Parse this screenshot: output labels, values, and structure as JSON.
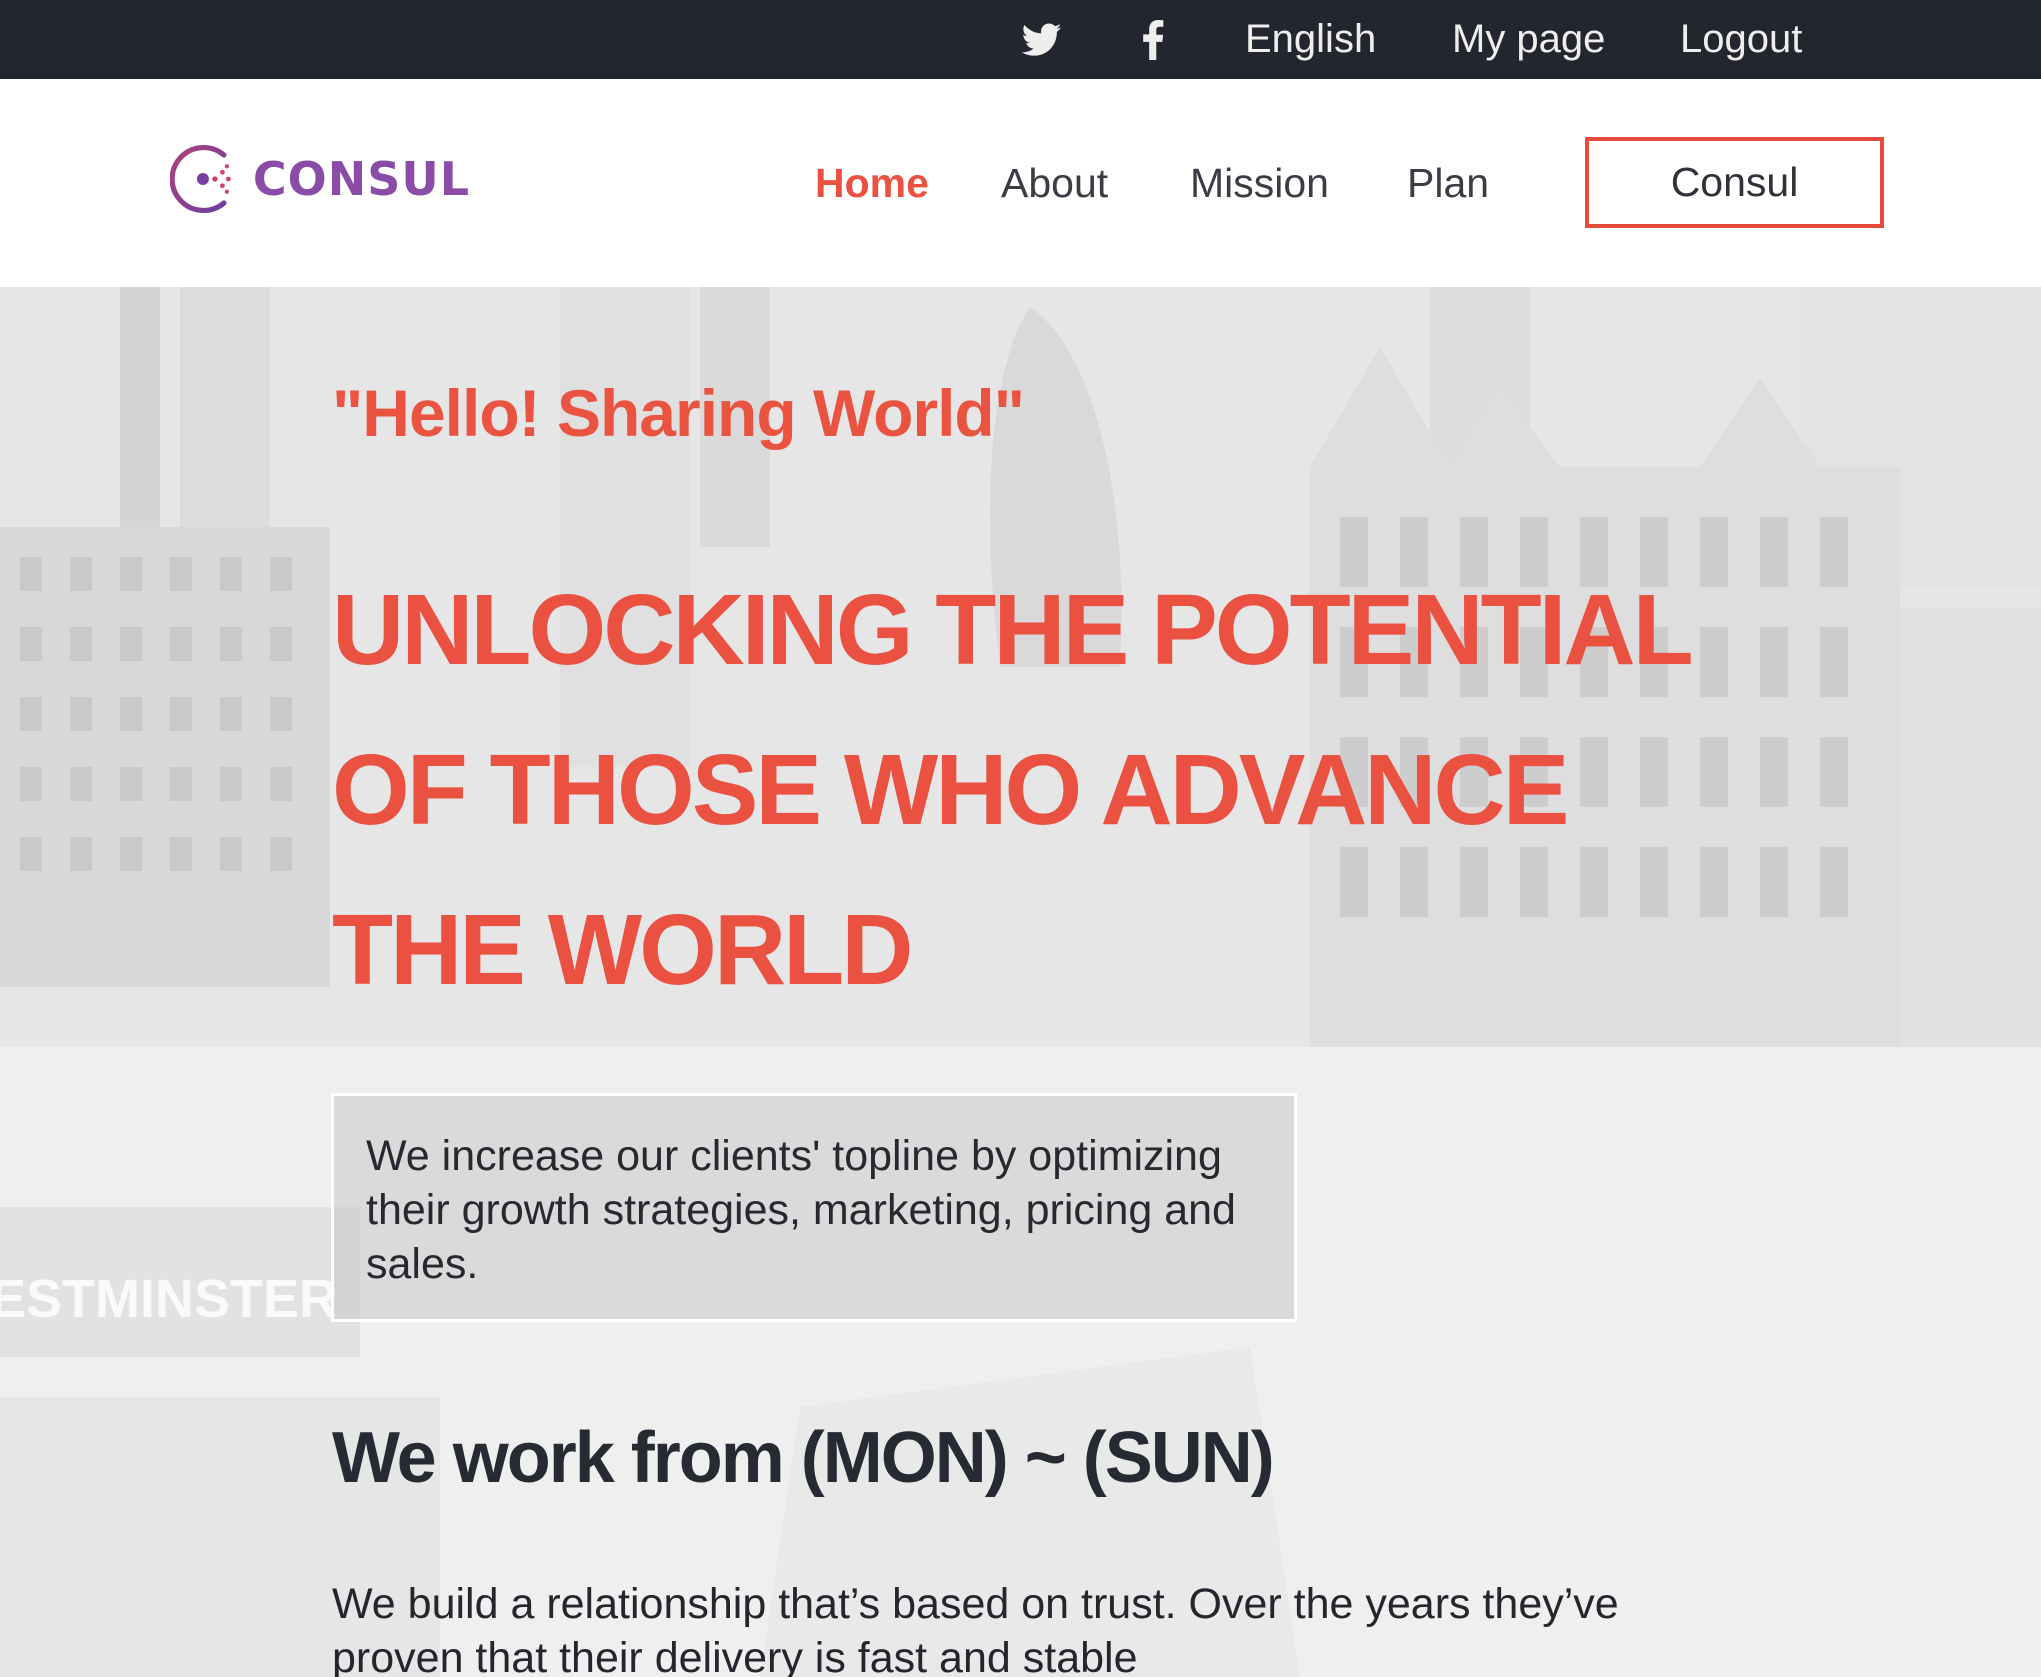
{
  "topbar": {
    "twitter_icon": "twitter-icon",
    "facebook_icon": "facebook-icon",
    "language": "English",
    "my_page": "My page",
    "logout": "Logout"
  },
  "header": {
    "logo_text": "CONSUL",
    "nav": {
      "home": "Home",
      "about": "About",
      "mission": "Mission",
      "plan": "Plan"
    },
    "cta_label": "Consul"
  },
  "hero": {
    "tagline": "\"Hello! Sharing World\"",
    "headline_lines": [
      "UNLOCKING THE POTENTIAL",
      "OF THOSE WHO ADVANCE",
      "THE WORLD"
    ],
    "infobox_text": "We increase our clients' topline by optimizing their growth strategies, marketing, pricing and sales.",
    "subheading": "We work from (MON) ~ (SUN)",
    "body_text": "We build a relationship that’s based on trust. Over the years they’ve proven that their delivery is fast and stable",
    "background_sign": "ESTMINSTER"
  },
  "colors": {
    "accent": "#ea5140",
    "topbar_bg": "#23262e",
    "logo_purple": "#8a4ca7",
    "text_dark": "#262a33"
  }
}
